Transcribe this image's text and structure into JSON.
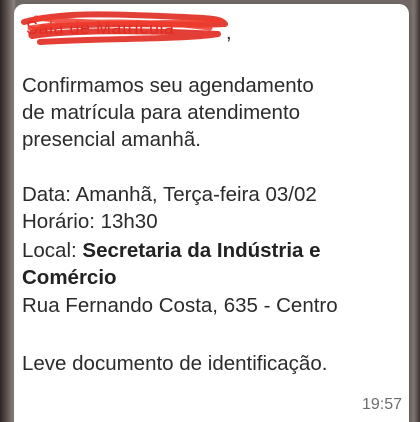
{
  "message": {
    "sender_name": "Sala de Matrícula",
    "sender_punct": ",",
    "lines": [
      "Confirmamos seu agendamento",
      "de matrícula para atendimento",
      "presencial amanhã."
    ],
    "date_line": "Data: Amanhã, Terça-feira 03/02",
    "time_line": "Horário: 13h30",
    "location_label": "Local: ",
    "location_name_1": "Secretaria da Indústria e",
    "location_name_2": "Comércio",
    "address": "Rua Fernando Costa, 635 - Centro",
    "closing": "Leve documento de identificação.",
    "timestamp": "19:57"
  },
  "colors": {
    "sender_redaction": "#e02a20",
    "bubble": "#ffffff",
    "text": "#2b2b2b",
    "timestamp": "#6d6d6d"
  }
}
